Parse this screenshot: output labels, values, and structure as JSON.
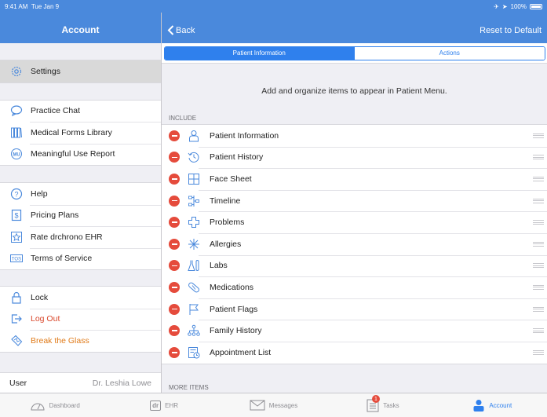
{
  "status": {
    "time": "9:41 AM",
    "date": "Tue Jan 9",
    "battery": "100%"
  },
  "left": {
    "title": "Account",
    "groups": [
      [
        {
          "label": "Settings",
          "icon": "gear-icon",
          "selected": true
        }
      ],
      [
        {
          "label": "Practice Chat",
          "icon": "chat-bubble-icon"
        },
        {
          "label": "Medical Forms Library",
          "icon": "books-icon"
        },
        {
          "label": "Meaningful Use Report",
          "icon": "mu-badge-icon"
        }
      ],
      [
        {
          "label": "Help",
          "icon": "help-icon"
        },
        {
          "label": "Pricing Plans",
          "icon": "dollar-icon"
        },
        {
          "label": "Rate drchrono EHR",
          "icon": "star-icon"
        },
        {
          "label": "Terms of Service",
          "icon": "tos-icon"
        }
      ],
      [
        {
          "label": "Lock",
          "icon": "lock-icon"
        },
        {
          "label": "Log Out",
          "icon": "logout-icon",
          "color": "red"
        },
        {
          "label": "Break the Glass",
          "icon": "glass-icon",
          "color": "orange"
        }
      ]
    ],
    "user_label": "User",
    "user_name": "Dr. Leshia Lowe"
  },
  "right": {
    "back_label": "Back",
    "reset_label": "Reset to Default",
    "segments": [
      "Patient Information",
      "Actions"
    ],
    "active_segment": 0,
    "instruction": "Add and organize items to appear in Patient Menu.",
    "include_header": "INCLUDE",
    "include_items": [
      {
        "label": "Patient Information",
        "icon": "person-icon"
      },
      {
        "label": "Patient History",
        "icon": "history-icon"
      },
      {
        "label": "Face Sheet",
        "icon": "face-sheet-icon"
      },
      {
        "label": "Timeline",
        "icon": "timeline-icon"
      },
      {
        "label": "Problems",
        "icon": "medical-cross-icon"
      },
      {
        "label": "Allergies",
        "icon": "allergies-icon"
      },
      {
        "label": "Labs",
        "icon": "labs-icon"
      },
      {
        "label": "Medications",
        "icon": "pill-icon"
      },
      {
        "label": "Patient Flags",
        "icon": "flag-icon"
      },
      {
        "label": "Family History",
        "icon": "family-tree-icon"
      },
      {
        "label": "Appointment List",
        "icon": "appointment-list-icon"
      }
    ],
    "more_header": "MORE ITEMS"
  },
  "tabs": [
    {
      "label": "Dashboard",
      "icon": "gauge-icon"
    },
    {
      "label": "EHR",
      "icon": "dr-icon"
    },
    {
      "label": "Messages",
      "icon": "envelope-icon"
    },
    {
      "label": "Tasks",
      "icon": "tasks-icon",
      "badge": "1"
    },
    {
      "label": "Account",
      "icon": "account-icon",
      "active": true
    }
  ],
  "colors": {
    "primary": "#4a89dc",
    "accent": "#2f80ed",
    "delete": "#e54b3c",
    "logout": "#d9472b",
    "glass": "#e07b1a"
  }
}
